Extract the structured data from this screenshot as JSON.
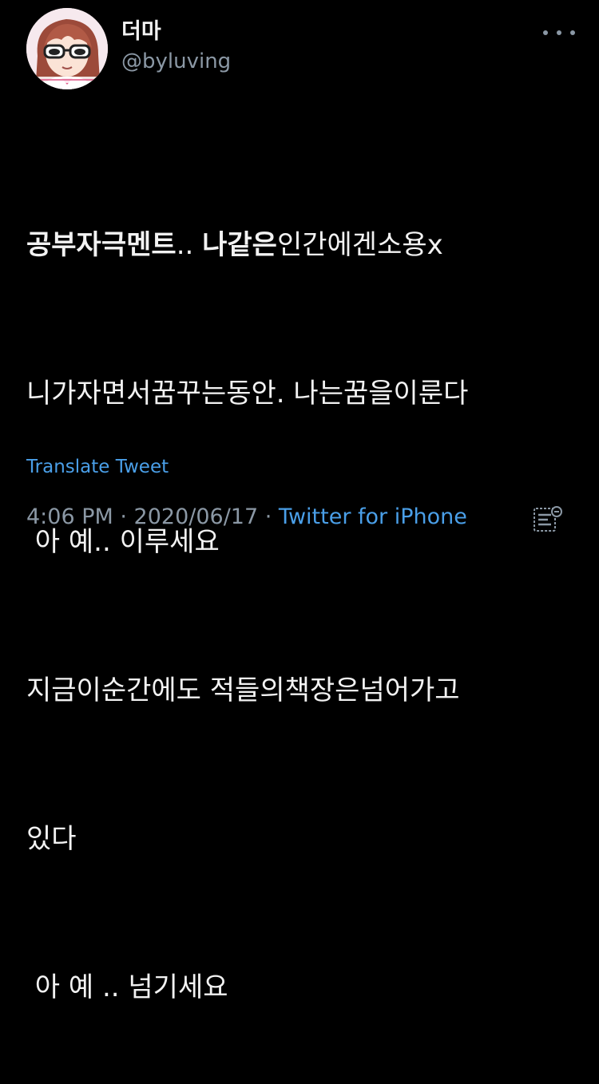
{
  "author": {
    "display_name": "더마",
    "handle": "@byluving"
  },
  "tweet": {
    "lines": [
      [
        {
          "text": "공부자극멘트",
          "bold": true
        },
        {
          "text": ".. ",
          "bold": false
        },
        {
          "text": "나같은",
          "bold": true
        },
        {
          "text": "인간에겐소용x",
          "bold": false
        }
      ],
      [
        {
          "text": "니가자면서꿈꾸는동안. 나는꿈을이룬다",
          "bold": false
        }
      ],
      [
        {
          "text": " 아 예.. 이루세요",
          "bold": false
        }
      ],
      [
        {
          "text": "지금이순간에도 적들의책장은넘어가고",
          "bold": false
        }
      ],
      [
        {
          "text": "있다",
          "bold": false
        }
      ],
      [
        {
          "text": " 아 예 .. 넘기세요",
          "bold": false
        }
      ]
    ],
    "translate_label": "Translate Tweet"
  },
  "meta": {
    "time": "4:06 PM",
    "separator": " · ",
    "date": "2020/06/17",
    "source": "Twitter for iPhone"
  },
  "icons": {
    "more": "more-horizontal-icon",
    "analytics": "analytics-icon"
  },
  "colors": {
    "background": "#000000",
    "text": "#f2f2f2",
    "secondary": "#8b98a5",
    "link": "#4a9fe8"
  }
}
